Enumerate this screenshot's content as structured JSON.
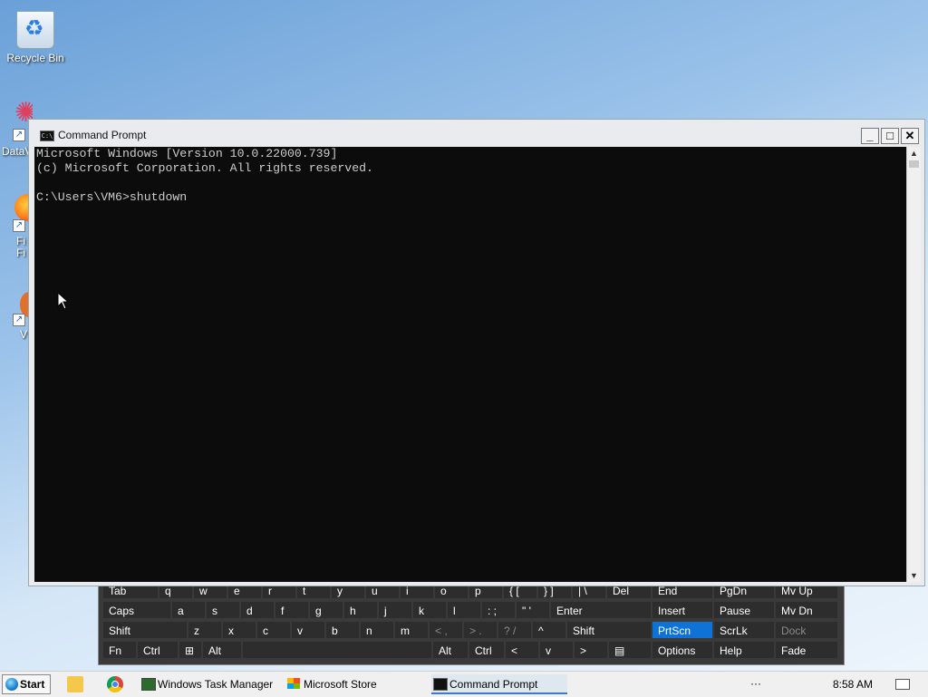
{
  "desktop": {
    "icons": [
      {
        "label": "Recycle Bin"
      },
      {
        "label": "DataV"
      },
      {
        "label": "Fi\nFi"
      },
      {
        "label": "V"
      }
    ]
  },
  "osk": {
    "rows": [
      [
        "Tab",
        "q",
        "w",
        "e",
        "r",
        "t",
        "y",
        "u",
        "i",
        "o",
        "p",
        "{ [",
        "} ]",
        "| \\",
        "Del"
      ],
      [
        "Caps",
        "a",
        "s",
        "d",
        "f",
        "g",
        "h",
        "j",
        "k",
        "l",
        ": ;",
        "\" '",
        "Enter"
      ],
      [
        "Shift",
        "z",
        "x",
        "c",
        "v",
        "b",
        "n",
        "m",
        "< ,",
        "> .",
        "? /",
        "^",
        "Shift"
      ],
      [
        "Fn",
        "Ctrl",
        "⊞",
        "Alt",
        "Alt",
        "Ctrl",
        "<",
        "v",
        ">",
        "▤"
      ]
    ],
    "side": [
      [
        "End",
        "PgDn",
        "Mv Up"
      ],
      [
        "Insert",
        "Pause",
        "Mv Dn"
      ],
      [
        "PrtScn",
        "ScrLk",
        "Dock"
      ],
      [
        "Options",
        "Help",
        "Fade"
      ]
    ],
    "highlighted": "PrtScn",
    "dim": "Dock"
  },
  "window": {
    "title": "Command Prompt",
    "minimize_label": "_",
    "maximize_label": "□",
    "close_label": "✕",
    "console_lines": [
      "Microsoft Windows [Version 10.0.22000.739]",
      "(c) Microsoft Corporation. All rights reserved.",
      "",
      "C:\\Users\\VM6>shutdown"
    ]
  },
  "taskbar": {
    "start_label": "Start",
    "items": [
      {
        "label": "Windows Task Manager",
        "icon": "task-manager-icon"
      },
      {
        "label": "Microsoft Store",
        "icon": "store-icon"
      },
      {
        "label": "Command Prompt",
        "icon": "cmd-icon",
        "active": true
      }
    ],
    "tray_more": "···",
    "clock": "8:58 AM"
  },
  "colors": {
    "console_bg": "#0c0c0c",
    "console_fg": "#cccccc",
    "highlight": "#0e72d6"
  }
}
